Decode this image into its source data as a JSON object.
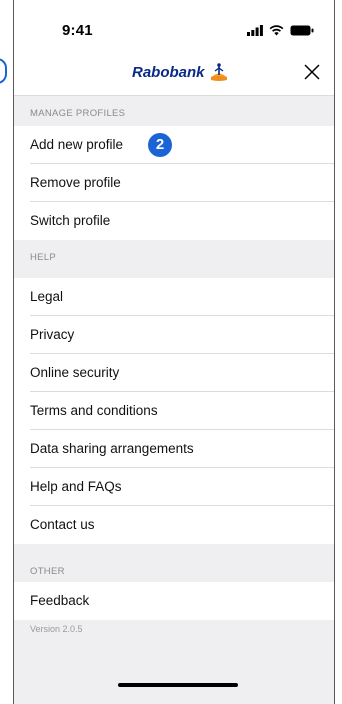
{
  "status_bar": {
    "time": "9:41"
  },
  "nav": {
    "brand": "Rabobank"
  },
  "sections": {
    "manage": {
      "header": "MANAGE PROFILES",
      "items": [
        "Add new profile",
        "Remove profile",
        "Switch profile"
      ]
    },
    "help": {
      "header": "HELP",
      "items": [
        "Legal",
        "Privacy",
        "Online security",
        "Terms and conditions",
        "Data sharing arrangements",
        "Help and FAQs",
        "Contact us"
      ]
    },
    "other": {
      "header": "OTHER",
      "items": [
        "Feedback"
      ]
    }
  },
  "badge": "2",
  "version": "Version 2.0.5",
  "colors": {
    "accent": "#1a64d6",
    "brand_text": "#0a2a8a",
    "background": "#efeff1"
  },
  "icons": [
    "signal-icon",
    "wifi-icon",
    "battery-icon",
    "rabobank-logo-icon",
    "close-icon"
  ]
}
